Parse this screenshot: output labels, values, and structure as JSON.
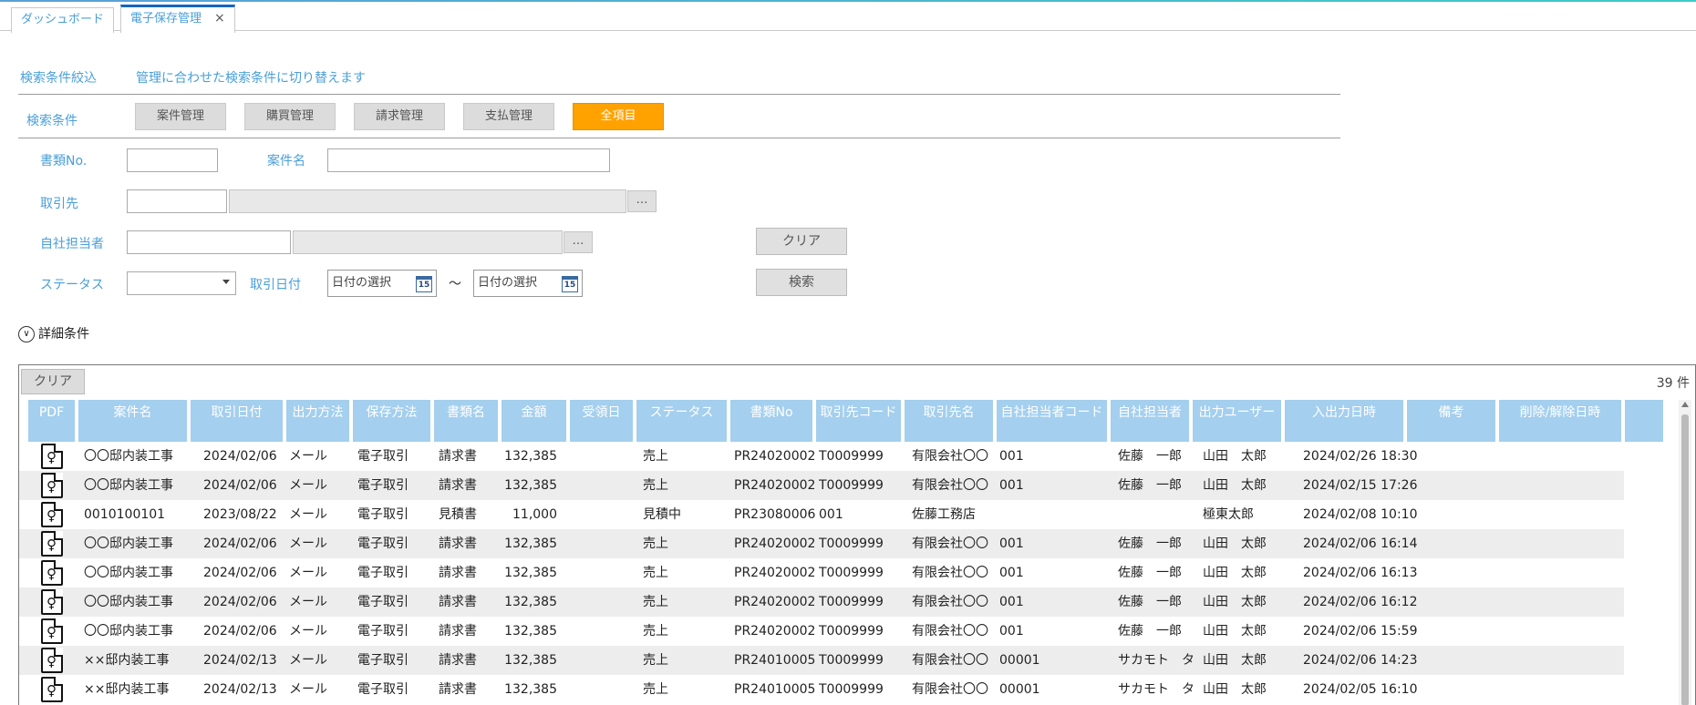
{
  "tabs": [
    {
      "label": "ダッシュボード"
    },
    {
      "label": "電子保存管理",
      "close": "×"
    }
  ],
  "filter": {
    "section_label": "検索条件絞込",
    "hint": "管理に合わせた検索条件に切り替えます",
    "cond_label": "検索条件",
    "categories": [
      "案件管理",
      "購買管理",
      "請求管理",
      "支払管理",
      "全項目"
    ],
    "active_category": "全項目"
  },
  "form": {
    "doc_no_label": "書類No.",
    "doc_no_value": "",
    "project_label": "案件名",
    "project_value": "",
    "partner_label": "取引先",
    "staff_label": "自社担当者",
    "status_label": "ステータス",
    "trade_date_label": "取引日付",
    "date_from_placeholder": "日付の選択",
    "date_to_placeholder": "日付の選択",
    "date_sep": "〜",
    "calendar_day": "15",
    "dots": "…",
    "clear_label": "クリア",
    "search_label": "検索"
  },
  "detail_label": "詳細条件",
  "grid": {
    "clear_label": "クリア",
    "count": "39 件",
    "columns": [
      "PDF",
      "案件名",
      "取引日付",
      "出力方法",
      "保存方法",
      "書類名",
      "金額",
      "受領日",
      "ステータス",
      "書類No",
      "取引先コード",
      "取引先名",
      "自社担当者コード",
      "自社担当者",
      "出力ユーザー",
      "入出力日時",
      "備考",
      "削除/解除日時"
    ],
    "rows": [
      {
        "project": "〇〇邸内装工事",
        "date": "2024/02/06",
        "output": "メール",
        "storage": "電子取引",
        "doc": "請求書",
        "amount": "132,385",
        "received": "",
        "status": "売上",
        "docno": "PR24020002",
        "pcode": "T0009999",
        "pname": "有限会社〇〇",
        "scode": "001",
        "staff": "佐藤　一郎",
        "user": "山田　太郎",
        "datetime": "2024/02/26 18:30"
      },
      {
        "project": "〇〇邸内装工事",
        "date": "2024/02/06",
        "output": "メール",
        "storage": "電子取引",
        "doc": "請求書",
        "amount": "132,385",
        "received": "",
        "status": "売上",
        "docno": "PR24020002",
        "pcode": "T0009999",
        "pname": "有限会社〇〇",
        "scode": "001",
        "staff": "佐藤　一郎",
        "user": "山田　太郎",
        "datetime": "2024/02/15 17:26"
      },
      {
        "project": "0010100101",
        "date": "2023/08/22",
        "output": "メール",
        "storage": "電子取引",
        "doc": "見積書",
        "amount": "11,000",
        "received": "",
        "status": "見積中",
        "docno": "PR23080006",
        "pcode": "001",
        "pname": "佐藤工務店",
        "scode": "",
        "staff": "",
        "user": "極東太郎",
        "datetime": "2024/02/08 10:10"
      },
      {
        "project": "〇〇邸内装工事",
        "date": "2024/02/06",
        "output": "メール",
        "storage": "電子取引",
        "doc": "請求書",
        "amount": "132,385",
        "received": "",
        "status": "売上",
        "docno": "PR24020002",
        "pcode": "T0009999",
        "pname": "有限会社〇〇",
        "scode": "001",
        "staff": "佐藤　一郎",
        "user": "山田　太郎",
        "datetime": "2024/02/06 16:14"
      },
      {
        "project": "〇〇邸内装工事",
        "date": "2024/02/06",
        "output": "メール",
        "storage": "電子取引",
        "doc": "請求書",
        "amount": "132,385",
        "received": "",
        "status": "売上",
        "docno": "PR24020002",
        "pcode": "T0009999",
        "pname": "有限会社〇〇",
        "scode": "001",
        "staff": "佐藤　一郎",
        "user": "山田　太郎",
        "datetime": "2024/02/06 16:13"
      },
      {
        "project": "〇〇邸内装工事",
        "date": "2024/02/06",
        "output": "メール",
        "storage": "電子取引",
        "doc": "請求書",
        "amount": "132,385",
        "received": "",
        "status": "売上",
        "docno": "PR24020002",
        "pcode": "T0009999",
        "pname": "有限会社〇〇",
        "scode": "001",
        "staff": "佐藤　一郎",
        "user": "山田　太郎",
        "datetime": "2024/02/06 16:12"
      },
      {
        "project": "〇〇邸内装工事",
        "date": "2024/02/06",
        "output": "メール",
        "storage": "電子取引",
        "doc": "請求書",
        "amount": "132,385",
        "received": "",
        "status": "売上",
        "docno": "PR24020002",
        "pcode": "T0009999",
        "pname": "有限会社〇〇",
        "scode": "001",
        "staff": "佐藤　一郎",
        "user": "山田　太郎",
        "datetime": "2024/02/06 15:59"
      },
      {
        "project": "××邸内装工事",
        "date": "2024/02/13",
        "output": "メール",
        "storage": "電子取引",
        "doc": "請求書",
        "amount": "132,385",
        "received": "",
        "status": "売上",
        "docno": "PR24010005",
        "pcode": "T0009999",
        "pname": "有限会社〇〇",
        "scode": "00001",
        "staff": "サカモト　タ",
        "user": "山田　太郎",
        "datetime": "2024/02/06 14:23"
      },
      {
        "project": "××邸内装工事",
        "date": "2024/02/13",
        "output": "メール",
        "storage": "電子取引",
        "doc": "請求書",
        "amount": "132,385",
        "received": "",
        "status": "売上",
        "docno": "PR24010005",
        "pcode": "T0009999",
        "pname": "有限会社〇〇",
        "scode": "00001",
        "staff": "サカモト　タ",
        "user": "山田　太郎",
        "datetime": "2024/02/05 16:10"
      }
    ]
  }
}
